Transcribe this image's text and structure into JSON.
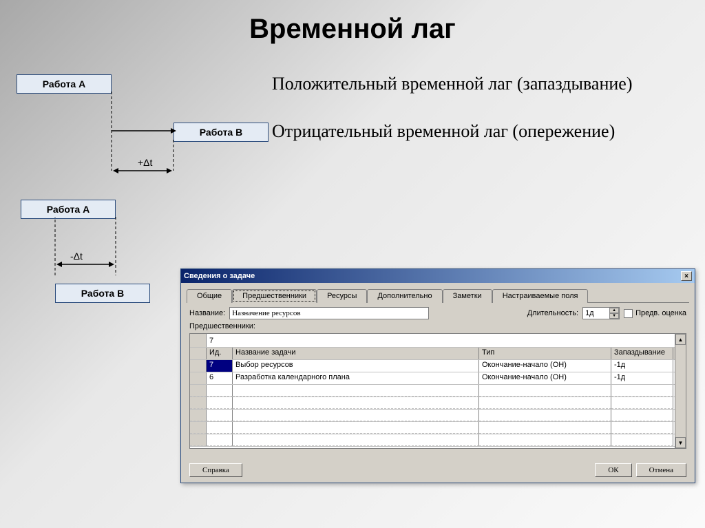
{
  "title": "Временной лаг",
  "paragraphs": {
    "p1": "Положительный временной лаг (запаздывание)",
    "p2": "Отрицательный временной лаг (опережение)"
  },
  "diagram": {
    "taskA": "Работа А",
    "taskB": "Работа В",
    "plusDelta": "+Δt",
    "minusDelta": "-Δt"
  },
  "dialog": {
    "title": "Сведения о задаче",
    "closeGlyph": "×",
    "tabs": {
      "general": "Общие",
      "predecessors": "Предшественники",
      "resources": "Ресурсы",
      "advanced": "Дополнительно",
      "notes": "Заметки",
      "custom": "Настраиваемые поля"
    },
    "form": {
      "nameLabel": "Название:",
      "nameValue": "Назначение ресурсов",
      "durationLabel": "Длительность:",
      "durationValue": "1д",
      "estimateLabel": "Предв. оценка",
      "predecessorsLabel": "Предшественники:",
      "editValue": "7"
    },
    "columns": {
      "id": "Ид.",
      "name": "Название задачи",
      "type": "Тип",
      "lag": "Запаздывание"
    },
    "rows": [
      {
        "id": "7",
        "name": "Выбор ресурсов",
        "type": "Окончание-начало (ОН)",
        "lag": "-1д"
      },
      {
        "id": "6",
        "name": "Разработка календарного плана",
        "type": "Окончание-начало (ОН)",
        "lag": "-1д"
      }
    ],
    "buttons": {
      "help": "Справка",
      "ok": "ОК",
      "cancel": "Отмена"
    }
  }
}
